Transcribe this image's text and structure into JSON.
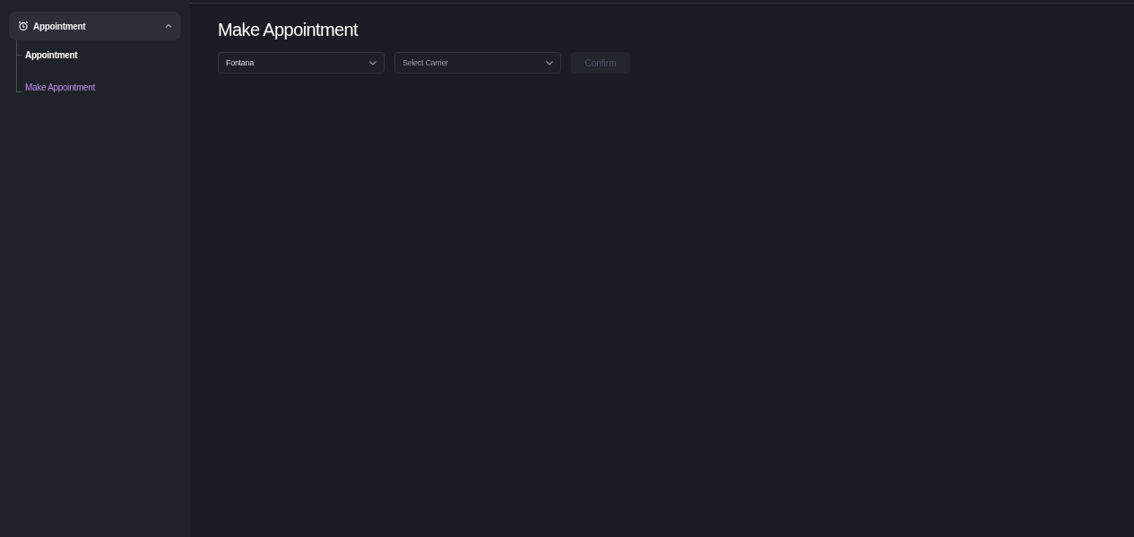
{
  "sidebar": {
    "group": {
      "label": "Appointment",
      "expanded": true,
      "items": [
        {
          "label": "Appointment",
          "selected": false
        },
        {
          "label": "Make Appointment",
          "selected": true
        }
      ]
    }
  },
  "page": {
    "title": "Make Appointment",
    "filters": [
      {
        "value": "Fontana"
      },
      {
        "placeholder": "Select Carrier"
      }
    ],
    "confirm": {
      "label": "Confirm",
      "disabled": true
    }
  }
}
